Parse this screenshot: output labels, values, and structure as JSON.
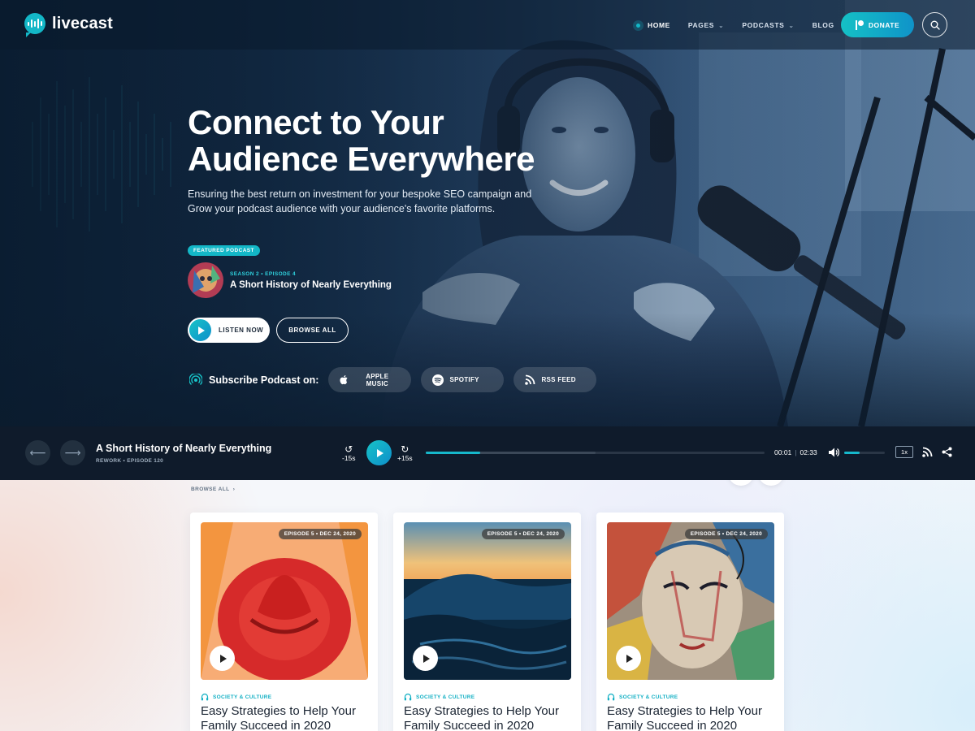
{
  "brand": {
    "name": "livecast",
    "accent": "#13b7c7",
    "accent_dark": "#0e8fca"
  },
  "nav": {
    "items": [
      {
        "label": "HOME",
        "active": true,
        "dropdown": false
      },
      {
        "label": "PAGES",
        "active": false,
        "dropdown": true
      },
      {
        "label": "PODCASTS",
        "active": false,
        "dropdown": true
      },
      {
        "label": "BLOG",
        "active": false,
        "dropdown": false
      }
    ],
    "donate_label": "DONATE",
    "search_icon": "search-icon"
  },
  "hero": {
    "title_line1": "Connect to Your",
    "title_line2": "Audience Everywhere",
    "subtitle": "Ensuring the best return on investment for your bespoke SEO campaign and Grow your podcast audience with your audience's favorite platforms.",
    "featured_badge": "FEATURED PODCAST",
    "featured_meta": "SEASON 2 • EPISODE 4",
    "featured_title": "A Short History of Nearly Everything",
    "listen_label": "LISTEN NOW",
    "browse_label": "BROWSE ALL"
  },
  "subscribe": {
    "label": "Subscribe Podcast on:",
    "platforms": [
      {
        "label": "APPLE MUSIC",
        "icon": "apple-icon"
      },
      {
        "label": "SPOTIFY",
        "icon": "spotify-icon"
      },
      {
        "label": "RSS FEED",
        "icon": "rss-icon"
      }
    ]
  },
  "player": {
    "title": "A Short History of Nearly Everything",
    "meta": "REWORK  •  EPISODE 120",
    "skip_back": "-15s",
    "skip_forward": "+15s",
    "current_time": "00:01",
    "duration": "02:33",
    "progress_fraction": 0.16,
    "buffered_fraction": 0.5,
    "volume_fraction": 0.38,
    "speed": "1x"
  },
  "episodes": {
    "browse_label": "BROWSE ALL",
    "cards": [
      {
        "badge": "EPISODE 5  •  DEC 24, 2020",
        "category": "SOCIETY & CULTURE",
        "title": "Easy Strategies to Help Your Family Succeed in 2020",
        "image": "red-hat-on-orange"
      },
      {
        "badge": "EPISODE 5  •  DEC 24, 2020",
        "category": "SOCIETY & CULTURE",
        "title": "Easy Strategies to Help Your Family Succeed in 2020",
        "image": "ocean-wave-sunset"
      },
      {
        "badge": "EPISODE 5  •  DEC 24, 2020",
        "category": "SOCIETY & CULTURE",
        "title": "Easy Strategies to Help Your Family Succeed in 2020",
        "image": "painted-face-art"
      }
    ]
  }
}
